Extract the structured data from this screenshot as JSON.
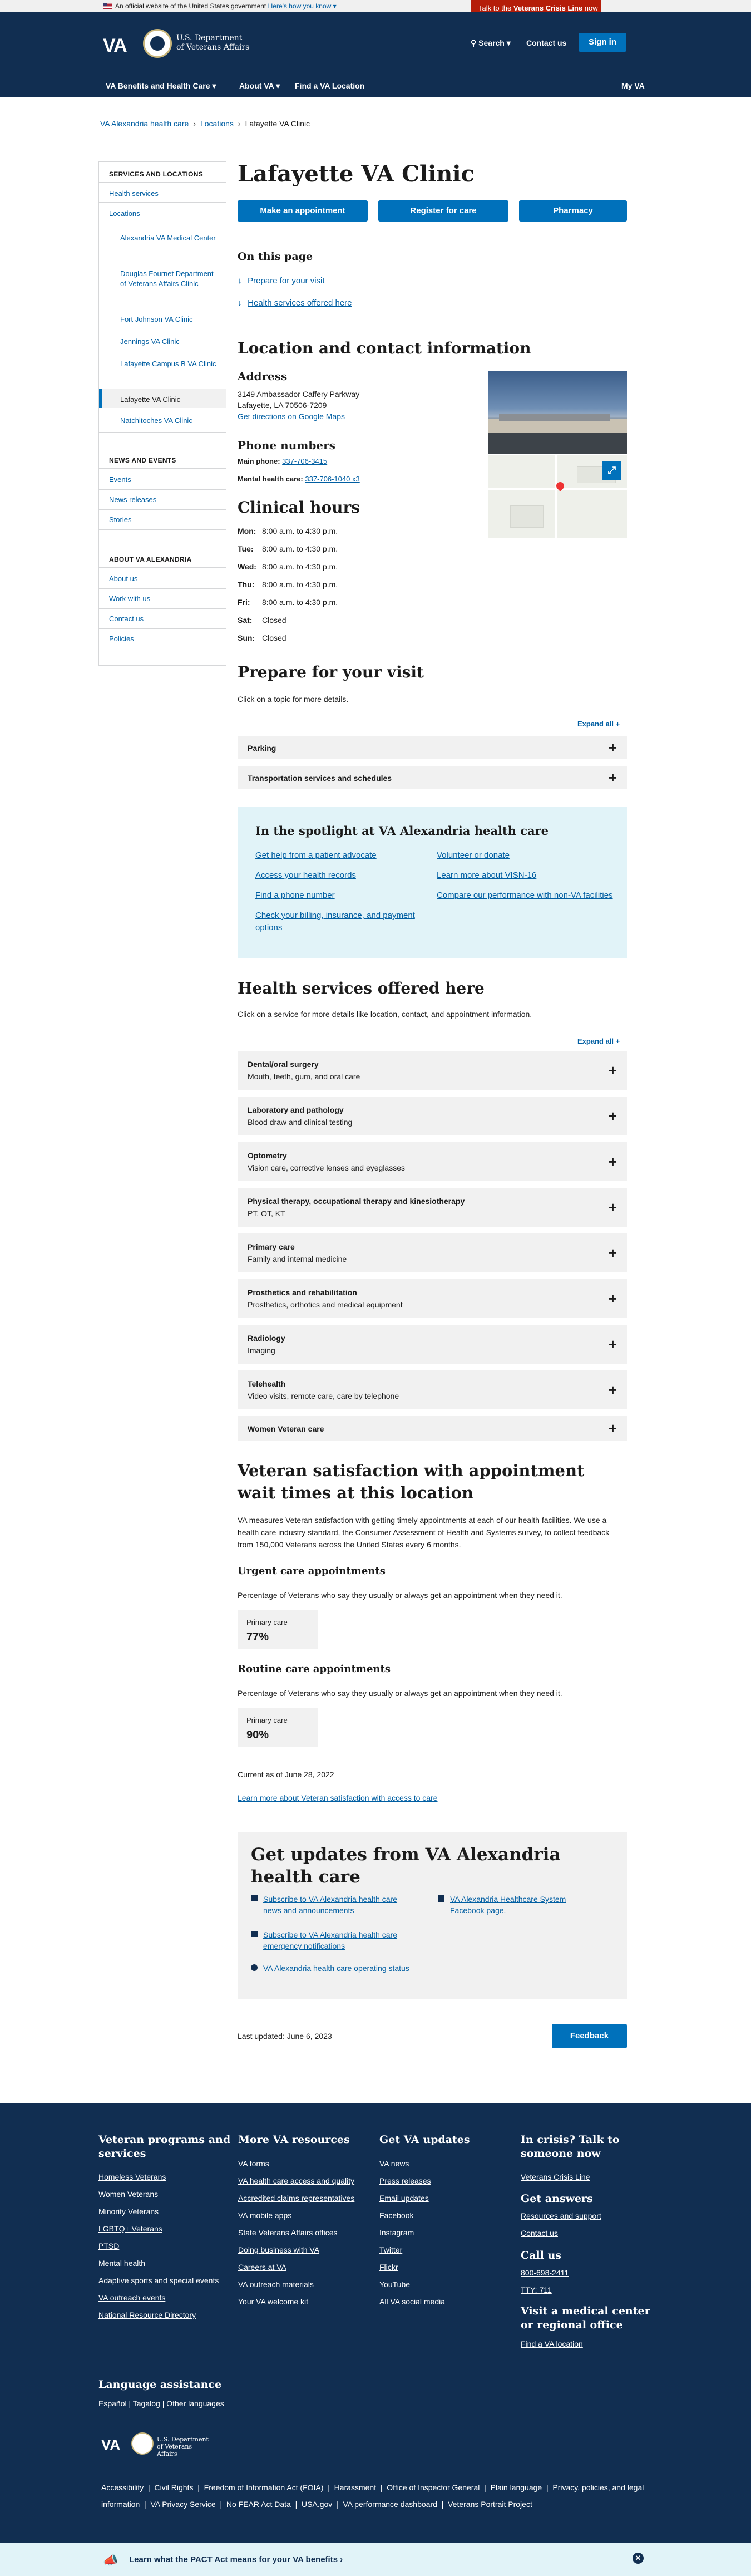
{
  "gov_banner": {
    "text": "An official website of the United States government",
    "link": "Here's how you know"
  },
  "crisis_line": {
    "prefix": "Talk to the ",
    "strong": "Veterans Crisis Line",
    "suffix": " now"
  },
  "header": {
    "logo_abbr": "VA",
    "dept_line1": "U.S. Department",
    "dept_line2": "of Veterans Affairs",
    "search": "Search",
    "contact": "Contact us",
    "signin": "Sign in",
    "nav": [
      "VA Benefits and Health Care",
      "About VA",
      "Find a VA Location",
      "My VA"
    ]
  },
  "breadcrumb": [
    "VA Alexandria health care",
    "Locations",
    "Lafayette VA Clinic"
  ],
  "sidebar": {
    "heading1": "SERVICES AND LOCATIONS",
    "health_services": "Health services",
    "locations": "Locations",
    "sub": [
      "Alexandria VA Medical Center",
      "Douglas Fournet Department of Veterans Affairs Clinic",
      "Fort Johnson VA Clinic",
      "Jennings VA Clinic",
      "Lafayette Campus B VA Clinic",
      "Lafayette VA Clinic",
      "Natchitoches VA Clinic"
    ],
    "heading2": "NEWS AND EVENTS",
    "news": [
      "Events",
      "News releases",
      "Stories"
    ],
    "heading3": "ABOUT VA ALEXANDRIA",
    "about": [
      "About us",
      "Work with us",
      "Contact us",
      "Policies"
    ]
  },
  "page": {
    "title": "Lafayette VA Clinic",
    "buttons": [
      "Make an appointment",
      "Register for care",
      "Pharmacy"
    ],
    "on_this_page": "On this page",
    "on_page_links": [
      "Prepare for your visit",
      "Health services offered here"
    ]
  },
  "location": {
    "heading": "Location and contact information",
    "address_heading": "Address",
    "address1": "3149 Ambassador Caffery Parkway",
    "address2": "Lafayette, LA 70506-7209",
    "directions": "Get directions on Google Maps",
    "phone_heading": "Phone numbers",
    "main_label": "Main phone:",
    "main_phone": "337-706-3415",
    "mental_label": "Mental health care:",
    "mental_phone": "337-706-1040 x3"
  },
  "hours": {
    "heading": "Clinical hours",
    "rows": [
      {
        "day": "Mon:",
        "time": "8:00 a.m. to 4:30 p.m."
      },
      {
        "day": "Tue:",
        "time": "8:00 a.m. to 4:30 p.m."
      },
      {
        "day": "Wed:",
        "time": "8:00 a.m. to 4:30 p.m."
      },
      {
        "day": "Thu:",
        "time": "8:00 a.m. to 4:30 p.m."
      },
      {
        "day": "Fri:",
        "time": "8:00 a.m. to 4:30 p.m."
      },
      {
        "day": "Sat:",
        "time": "Closed"
      },
      {
        "day": "Sun:",
        "time": "Closed"
      }
    ]
  },
  "prepare": {
    "heading": "Prepare for your visit",
    "intro": "Click on a topic for more details.",
    "expand": "Expand all +",
    "items": [
      "Parking",
      "Transportation services and schedules"
    ]
  },
  "spotlight": {
    "heading": "In the spotlight at VA Alexandria health care",
    "left": [
      "Get help from a patient advocate",
      "Access your health records",
      "Find a phone number",
      "Check your billing, insurance, and payment options"
    ],
    "right": [
      "Volunteer or donate",
      "Learn more about VISN-16",
      "Compare our performance with non-VA facilities"
    ]
  },
  "services": {
    "heading": "Health services offered here",
    "intro": "Click on a service for more details like location, contact, and appointment information.",
    "expand": "Expand all +",
    "items": [
      {
        "title": "Dental/oral surgery",
        "sub": "Mouth, teeth, gum, and oral care"
      },
      {
        "title": "Laboratory and pathology",
        "sub": "Blood draw and clinical testing"
      },
      {
        "title": "Optometry",
        "sub": "Vision care, corrective lenses and eyeglasses"
      },
      {
        "title": "Physical therapy, occupational therapy and kinesiotherapy",
        "sub": "PT, OT, KT"
      },
      {
        "title": "Primary care",
        "sub": "Family and internal medicine"
      },
      {
        "title": "Prosthetics and rehabilitation",
        "sub": "Prosthetics, orthotics and medical equipment"
      },
      {
        "title": "Radiology",
        "sub": "Imaging"
      },
      {
        "title": "Telehealth",
        "sub": "Video visits, remote care, care by telephone"
      },
      {
        "title": "Women Veteran care",
        "sub": ""
      }
    ]
  },
  "satisfaction": {
    "heading": "Veteran satisfaction with appointment wait times at this location",
    "body": "VA measures Veteran satisfaction with getting timely appointments at each of our health facilities. We use a health care industry standard, the Consumer Assessment of Health and Systems survey, to collect feedback from 150,000 Veterans across the United States every 6 months.",
    "urgent_heading": "Urgent care appointments",
    "urgent_desc": "Percentage of Veterans who say they usually or always get an appointment when they need it.",
    "urgent_label": "Primary care",
    "urgent_value": "77%",
    "routine_heading": "Routine care appointments",
    "routine_desc": "Percentage of Veterans who say they usually or always get an appointment when they need it.",
    "routine_label": "Primary care",
    "routine_value": "90%",
    "current": "Current as of June 28, 2022",
    "learn_more": "Learn more about Veteran satisfaction with access to care"
  },
  "updates": {
    "heading": "Get updates from VA Alexandria health care",
    "links": [
      "Subscribe to VA Alexandria health care news and announcements",
      "Subscribe to VA Alexandria health care emergency notifications",
      "VA Alexandria health care operating status"
    ],
    "facebook": "VA Alexandria Healthcare System Facebook page."
  },
  "last_updated": "Last updated: June 6, 2023",
  "feedback": "Feedback",
  "footer": {
    "col1_heading": "Veteran programs and services",
    "col1": [
      "Homeless Veterans",
      "Women Veterans",
      "Minority Veterans",
      "LGBTQ+ Veterans",
      "PTSD",
      "Mental health",
      "Adaptive sports and special events",
      "VA outreach events",
      "National Resource Directory"
    ],
    "col2_heading": "More VA resources",
    "col2": [
      "VA forms",
      "VA health care access and quality",
      "Accredited claims representatives",
      "VA mobile apps",
      "State Veterans Affairs offices",
      "Doing business with VA",
      "Careers at VA",
      "VA outreach materials",
      "Your VA welcome kit"
    ],
    "col3_heading": "Get VA updates",
    "col3": [
      "VA news",
      "Press releases",
      "Email updates",
      "Facebook",
      "Instagram",
      "Twitter",
      "Flickr",
      "YouTube",
      "All VA social media"
    ],
    "col4_heading1": "In crisis? Talk to someone now",
    "col4_link1": "Veterans Crisis Line",
    "col4_heading2": "Get answers",
    "col4_links2": [
      "Resources and support",
      "Contact us"
    ],
    "col4_heading3": "Call us",
    "col4_links3": [
      "800-698-2411",
      "TTY: 711"
    ],
    "col4_heading4": "Visit a medical center or regional office",
    "col4_link4": "Find a VA location",
    "lang_heading": "Language assistance",
    "langs": [
      "Español",
      "Tagalog",
      "Other languages"
    ],
    "legal": [
      "Accessibility",
      "Civil Rights",
      "Freedom of Information Act (FOIA)",
      "Harassment",
      "Office of Inspector General",
      "Plain language",
      "Privacy, policies, and legal information",
      "VA Privacy Service",
      "No FEAR Act Data",
      "USA.gov",
      "VA performance dashboard",
      "Veterans Portrait Project"
    ]
  },
  "pact": "Learn what the PACT Act means for your VA benefits"
}
